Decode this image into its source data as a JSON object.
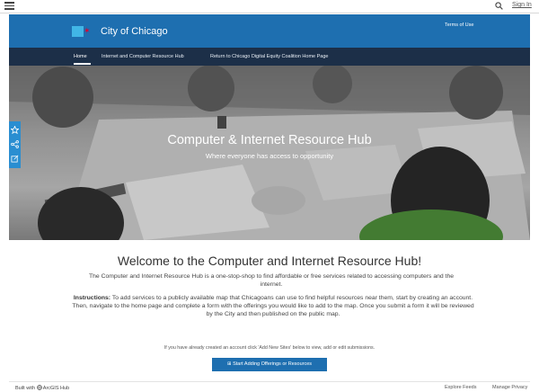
{
  "topbar": {
    "signin_label": "Sign In"
  },
  "header": {
    "site_title": "City of Chicago",
    "terms_label": "Terms of Use"
  },
  "nav": {
    "items": [
      {
        "label": "Home"
      },
      {
        "label": "Internet and Computer Resource Hub"
      },
      {
        "label": "Return to Chicago Digital Equity Coalition Home Page"
      }
    ]
  },
  "hero": {
    "title": "Computer & Internet Resource Hub",
    "subtitle": "Where everyone has access to opportunity"
  },
  "content": {
    "welcome": "Welcome to the Computer and Internet Resource Hub!",
    "intro": "The Computer and Internet Resource Hub is a one-stop-shop to find affordable or free services related to accessing computers and the internet.",
    "instructions_label": "Instructions:",
    "instructions": "To add services to a publicly available map that Chicagoans can use to find helpful resources near them, start by creating an account. Then, navigate to the home page and complete a form with the offerings you would like to add to the map. Once you submit a form it will be reviewed by the City and then published on the public map.",
    "already_text": "If you have already created an account click 'Add New Sites' below to view, add or edit submissions.",
    "start_button_label": "Start Adding Offerings or Resources"
  },
  "footer": {
    "built_with": "Built with",
    "hub_label": "ArcGIS Hub",
    "explore_feeds": "Explore Feeds",
    "manage_privacy": "Manage Privacy"
  },
  "colors": {
    "header_blue": "#1e6fb0",
    "nav_dark": "#1c2f48",
    "side_rail": "#2a8ed1",
    "logo_cyan": "#41b6e6",
    "logo_red": "#e4002b"
  },
  "icons": [
    "menu-icon",
    "search-icon",
    "star-icon",
    "share-icon",
    "external-link-icon",
    "hub-globe-icon",
    "plus-icon"
  ]
}
